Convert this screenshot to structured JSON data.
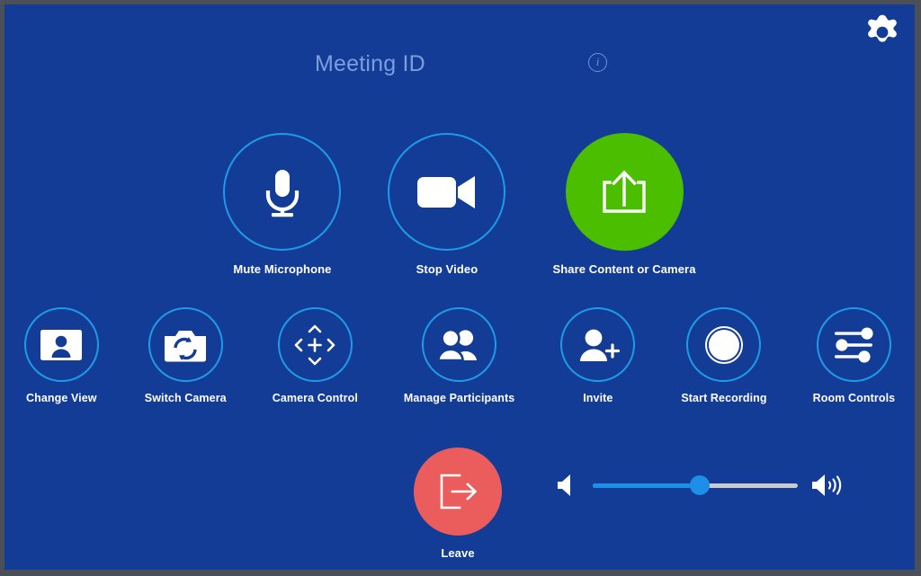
{
  "window": {
    "chrome_color": "#4a4f58",
    "screen_bg": "#133c96"
  },
  "header": {
    "meeting_title": "Meeting ID",
    "info_icon_glyph": "i",
    "info_icon_name": "info-icon",
    "settings_icon_name": "gear-icon"
  },
  "theme": {
    "accent_blue": "#1e9be8",
    "share_green": "#4cbe00",
    "leave_red": "#eb5d5d",
    "label_white": "#ffffff",
    "title_blue": "#7b9ede",
    "slider_fill": "#1e8fe8",
    "slider_track": "#c8ccd2"
  },
  "primary_actions": [
    {
      "id": "mute-microphone",
      "label": "Mute Microphone",
      "icon": "microphone-icon",
      "style": "outline"
    },
    {
      "id": "stop-video",
      "label": "Stop Video",
      "icon": "video-camera-icon",
      "style": "outline"
    },
    {
      "id": "share-content",
      "label": "Share Content or Camera",
      "icon": "share-upload-icon",
      "style": "filled-green"
    }
  ],
  "secondary_actions": [
    {
      "id": "change-view",
      "label": "Change View",
      "icon": "person-card-icon"
    },
    {
      "id": "switch-camera",
      "label": "Switch Camera",
      "icon": "camera-switch-icon"
    },
    {
      "id": "camera-control",
      "label": "Camera Control",
      "icon": "camera-pan-tilt-icon"
    },
    {
      "id": "manage-participants",
      "label": "Manage Participants",
      "icon": "people-icon"
    },
    {
      "id": "invite",
      "label": "Invite",
      "icon": "person-add-icon"
    },
    {
      "id": "start-recording",
      "label": "Start Recording",
      "icon": "record-circle-icon"
    },
    {
      "id": "room-controls",
      "label": "Room Controls",
      "icon": "sliders-icon"
    }
  ],
  "leave": {
    "label": "Leave",
    "icon": "exit-door-arrow-icon"
  },
  "volume": {
    "low_icon": "speaker-low-icon",
    "high_icon": "speaker-high-icon",
    "value_percent": 52
  }
}
